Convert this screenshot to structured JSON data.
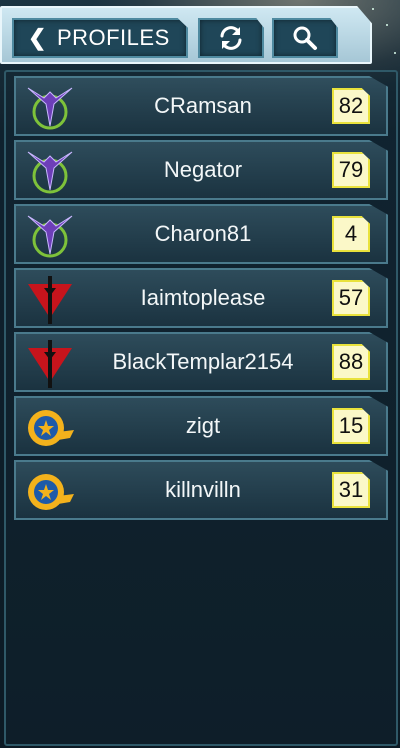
{
  "toolbar": {
    "back_label": "PROFILES",
    "back_icon": "chevron-left-icon",
    "refresh_icon": "refresh-icon",
    "search_icon": "search-icon"
  },
  "profiles": [
    {
      "name": "CRamsan",
      "level": "82",
      "faction": "ascendancy"
    },
    {
      "name": "Negator",
      "level": "79",
      "faction": "ascendancy"
    },
    {
      "name": "Charon81",
      "level": "4",
      "faction": "ascendancy"
    },
    {
      "name": "Iaimtoplease",
      "level": "57",
      "faction": "crimson"
    },
    {
      "name": "BlackTemplar2154",
      "level": "88",
      "faction": "crimson"
    },
    {
      "name": "zigt",
      "level": "15",
      "faction": "sol"
    },
    {
      "name": "killnvilln",
      "level": "31",
      "faction": "sol"
    }
  ],
  "colors": {
    "level_badge_bg": "#fbf8c8",
    "level_badge_border": "#e9e23c",
    "ascendancy_purple": "#6d3fb8",
    "ascendancy_green": "#7ec23a",
    "crimson_red": "#c7141c",
    "sol_gold": "#f3b21c",
    "sol_blue": "#1e5aa8"
  }
}
